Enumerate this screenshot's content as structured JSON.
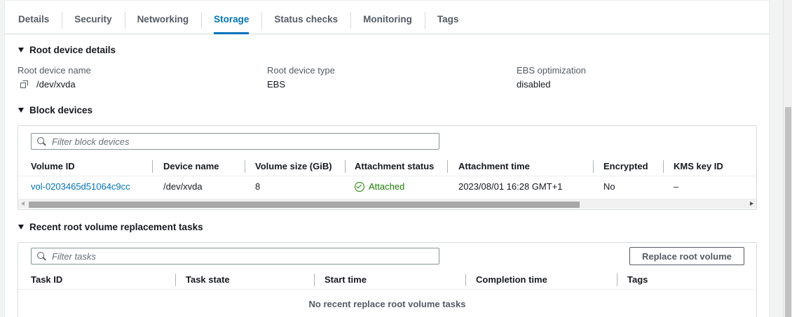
{
  "tabs": [
    {
      "label": "Details",
      "active": false
    },
    {
      "label": "Security",
      "active": false
    },
    {
      "label": "Networking",
      "active": false
    },
    {
      "label": "Storage",
      "active": true
    },
    {
      "label": "Status checks",
      "active": false
    },
    {
      "label": "Monitoring",
      "active": false
    },
    {
      "label": "Tags",
      "active": false
    }
  ],
  "root_device": {
    "title": "Root device details",
    "name_label": "Root device name",
    "name_value": "/dev/xvda",
    "type_label": "Root device type",
    "type_value": "EBS",
    "ebs_label": "EBS optimization",
    "ebs_value": "disabled"
  },
  "block_devices": {
    "title": "Block devices",
    "filter_placeholder": "Filter block devices",
    "columns": [
      "Volume ID",
      "Device name",
      "Volume size (GiB)",
      "Attachment status",
      "Attachment time",
      "Encrypted",
      "KMS key ID"
    ],
    "rows": [
      {
        "volume_id": "vol-0203465d51064c9cc",
        "device_name": "/dev/xvda",
        "size": "8",
        "status": "Attached",
        "time": "2023/08/01 16:28 GMT+1",
        "encrypted": "No",
        "kms": "–"
      }
    ]
  },
  "replacement_tasks": {
    "title": "Recent root volume replacement tasks",
    "filter_placeholder": "Filter tasks",
    "button_label": "Replace root volume",
    "columns": [
      "Task ID",
      "Task state",
      "Start time",
      "Completion time",
      "Tags"
    ],
    "empty_message": "No recent replace root volume tasks"
  },
  "colors": {
    "accent": "#0073bb",
    "success": "#1d8102",
    "text": "#16191f",
    "muted": "#545b64"
  }
}
